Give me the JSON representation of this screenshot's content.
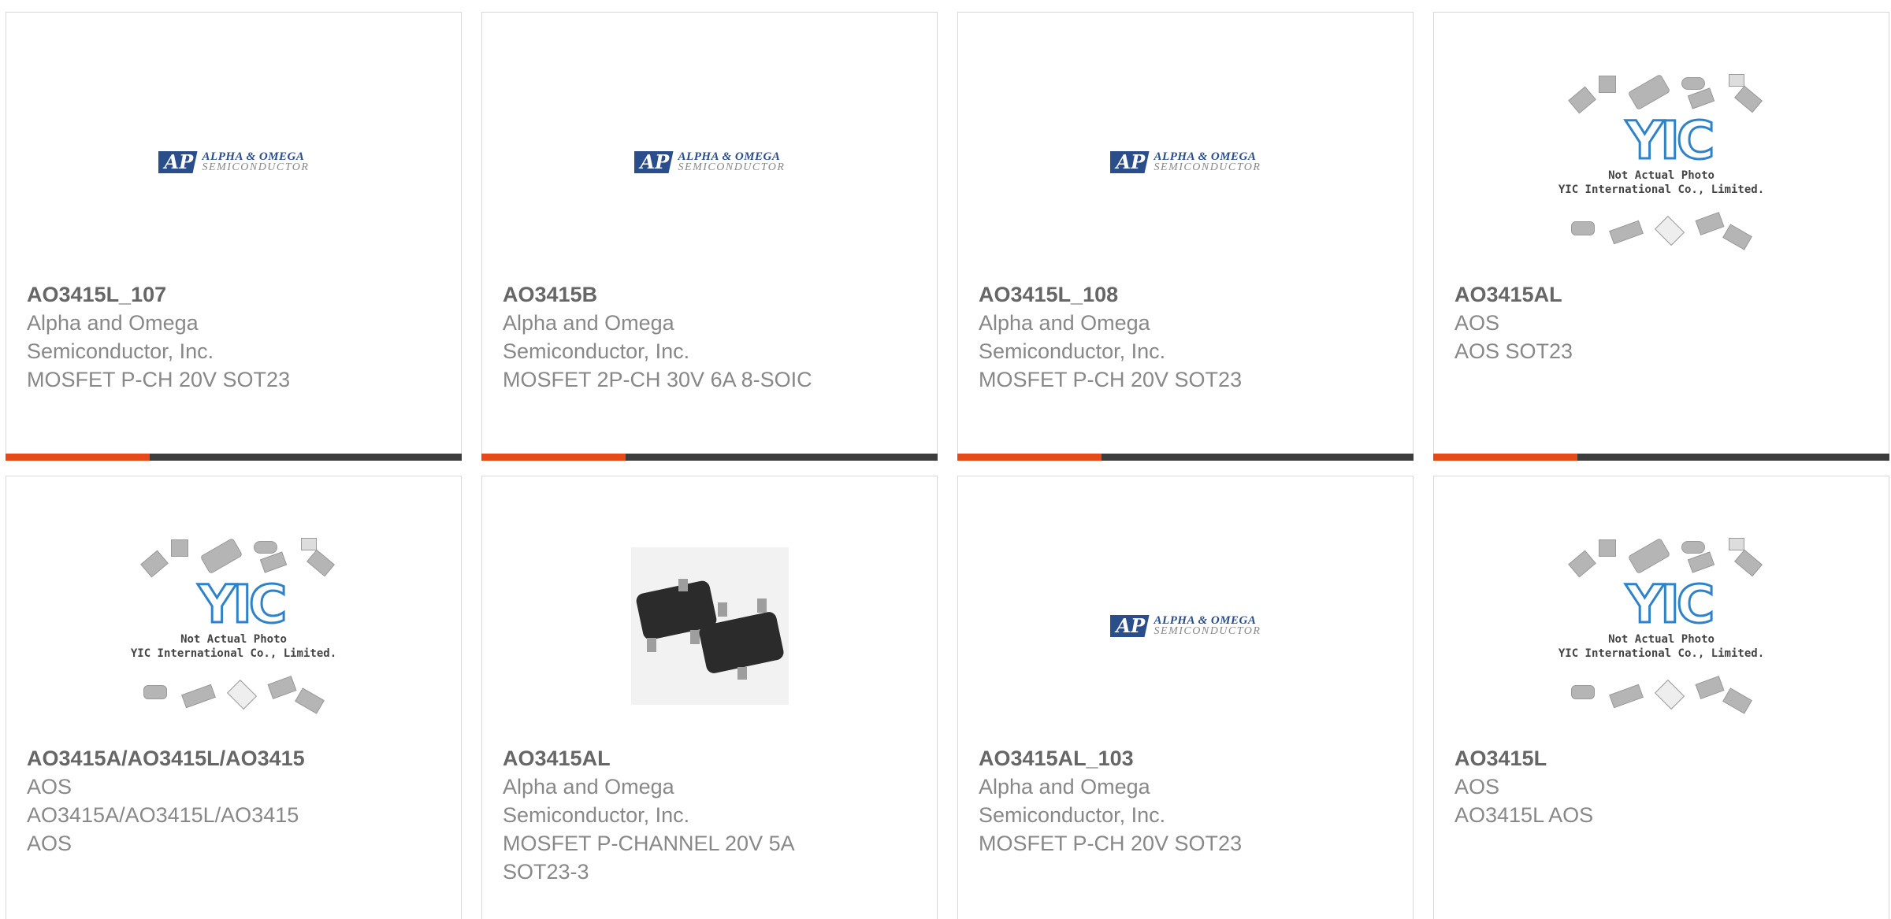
{
  "products": [
    {
      "part_number": "AO3415L_107",
      "lines": [
        "Alpha and Omega",
        "Semiconductor, Inc.",
        "MOSFET P-CH 20V SOT23"
      ],
      "image": "aos-logo"
    },
    {
      "part_number": "AO3415B",
      "lines": [
        "Alpha and Omega",
        "Semiconductor, Inc.",
        "MOSFET 2P-CH 30V 6A 8-SOIC"
      ],
      "image": "aos-logo"
    },
    {
      "part_number": "AO3415L_108",
      "lines": [
        "Alpha and Omega",
        "Semiconductor, Inc.",
        "MOSFET P-CH 20V SOT23"
      ],
      "image": "aos-logo"
    },
    {
      "part_number": "AO3415AL",
      "lines": [
        "AOS",
        "AOS SOT23"
      ],
      "image": "yic-placeholder"
    },
    {
      "part_number": "AO3415A/AO3415L/AO3415",
      "lines": [
        "AOS",
        "AO3415A/AO3415L/AO3415",
        "AOS"
      ],
      "image": "yic-placeholder"
    },
    {
      "part_number": "AO3415AL",
      "lines": [
        "Alpha and Omega",
        "Semiconductor, Inc.",
        "MOSFET P-CHANNEL 20V 5A",
        "SOT23-3"
      ],
      "image": "sot23-photo"
    },
    {
      "part_number": "AO3415AL_103",
      "lines": [
        "Alpha and Omega",
        "Semiconductor, Inc.",
        "MOSFET P-CH 20V SOT23"
      ],
      "image": "aos-logo"
    },
    {
      "part_number": "AO3415L",
      "lines": [
        "AOS",
        "AO3415L AOS"
      ],
      "image": "yic-placeholder"
    }
  ],
  "logo_text": {
    "line1": "ALPHA & OMEGA",
    "line2": "SEMICONDUCTOR"
  },
  "placeholder_text": {
    "line1": "Not Actual Photo",
    "line2": "YIC International Co., Limited."
  },
  "colors": {
    "accent": "#e64a19",
    "bar": "#3d3d3d",
    "logo_blue": "#2a4d8c",
    "yic_blue": "#2f82c8"
  }
}
